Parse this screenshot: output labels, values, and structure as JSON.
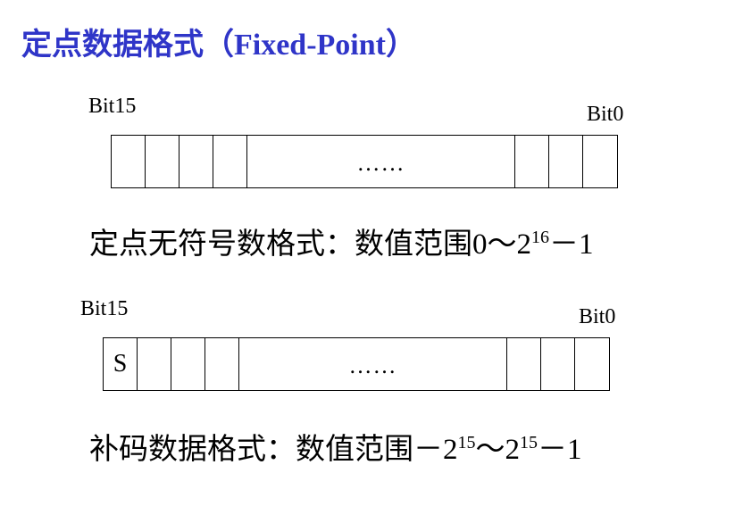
{
  "title": {
    "zh": "定点数据格式（",
    "en": "Fixed-Point",
    "close": "）"
  },
  "unsigned": {
    "msb_label": "Bit15",
    "lsb_label": "Bit0",
    "ellipsis": "……",
    "desc_prefix": "定点无符号数格式：数值范围",
    "range_a": "0～2",
    "exp_a": "16",
    "range_b": "－1"
  },
  "signed": {
    "msb_label": "Bit15",
    "lsb_label": "Bit0",
    "sign_label": "S",
    "ellipsis": "……",
    "desc_prefix": "补码数据格式：数值范围",
    "range_a": "－2",
    "exp_a": "15",
    "range_b": "～2",
    "exp_b": "15",
    "range_c": "－1"
  }
}
